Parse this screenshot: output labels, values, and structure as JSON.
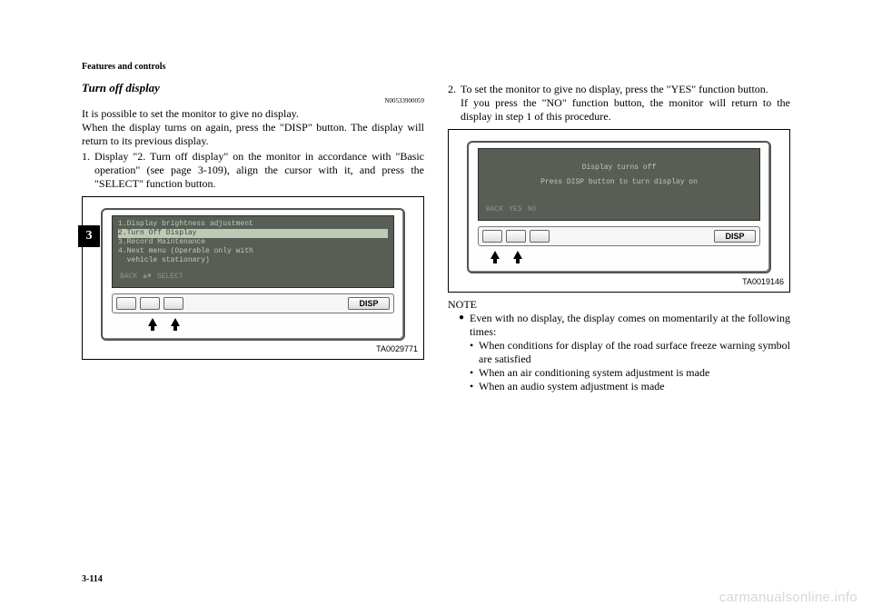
{
  "chapter": "Features and controls",
  "sideTab": "3",
  "pageNumber": "3-114",
  "watermark": "carmanualsonline.info",
  "left": {
    "title": "Turn off display",
    "docId": "N00533900059",
    "intro1": "It is possible to set the monitor to give no display.",
    "intro2": "When the display turns on again, press the \"DISP\" button. The display will return to its previous display.",
    "step1Num": "1.",
    "step1": "Display \"2. Turn off display\" on the monitor in accordance with \"Basic operation\" (see page 3-109), align the cursor with it, and press the \"SELECT\" function button.",
    "screen": {
      "l1": "1.Display brightness adjustment",
      "l2": "2.Turn Off Display",
      "l3": "3.Record Maintenance",
      "l4": "4.Next menu (Operable only with",
      "l5": "  vehicle stationary)",
      "sk1": "BACK",
      "sk2": "▲▼",
      "sk3": "SELECT"
    },
    "disp": "DISP",
    "figId": "TA0029771"
  },
  "right": {
    "step2Num": "2.",
    "step2a": "To set the monitor to give no display, press the \"YES\" function button.",
    "step2b": "If you press the \"NO\" function button, the monitor will return to the display in step 1 of this procedure.",
    "screen": {
      "t1": "Display turns off",
      "t2": "Press DISP button to turn display on",
      "sk1": "BACK",
      "sk2": "YES",
      "sk3": "NO"
    },
    "disp": "DISP",
    "figId": "TA0019146",
    "noteHead": "NOTE",
    "noteBullet": "Even with no display, the display comes on momentarily at the following times:",
    "sub1": "When conditions for display of the road surface freeze warning symbol are satisfied",
    "sub2": "When an air conditioning system adjustment is made",
    "sub3": "When an audio system adjustment is made"
  }
}
